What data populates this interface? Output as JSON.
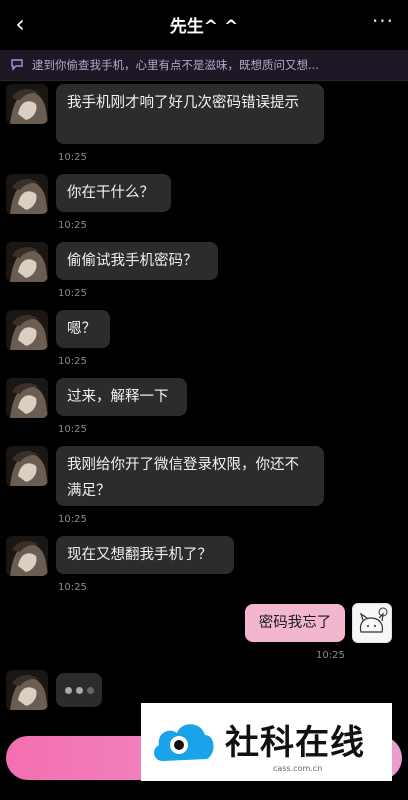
{
  "header": {
    "back_label": "‹",
    "title": "先生^ ^",
    "more_label": "···"
  },
  "banner": {
    "icon": "chat-bubble-icon",
    "text": "逮到你偷查我手机，心里有点不是滋味，既想质问又想..."
  },
  "messages": [
    {
      "text": "我手机刚才响了好几次密码错误提示",
      "time": "10:25"
    },
    {
      "text": "你在干什么？",
      "time": "10:25"
    },
    {
      "text": "偷偷试我手机密码？",
      "time": "10:25"
    },
    {
      "text": "嗯？",
      "time": "10:25"
    },
    {
      "text": "过来，解释一下",
      "time": "10:25"
    },
    {
      "text": "我刚给你开了微信登录权限，你还不满足？",
      "time": "10:25"
    },
    {
      "text": "现在又想翻我手机了？",
      "time": "10:25"
    }
  ],
  "mine": {
    "text": "密码我忘了",
    "time": "10:25"
  },
  "typing": {
    "icon": "typing-dots-icon"
  },
  "watermark": {
    "brand": "社科在线",
    "url": "cass.com.cn"
  },
  "colors": {
    "background": "#000000",
    "bubble": "#2c2c2e",
    "mine_bubble": "#f3b6cf",
    "banner": "#1e1726",
    "bottom_bar": "#f36fb0",
    "watermark_blue": "#1aa3e8"
  }
}
